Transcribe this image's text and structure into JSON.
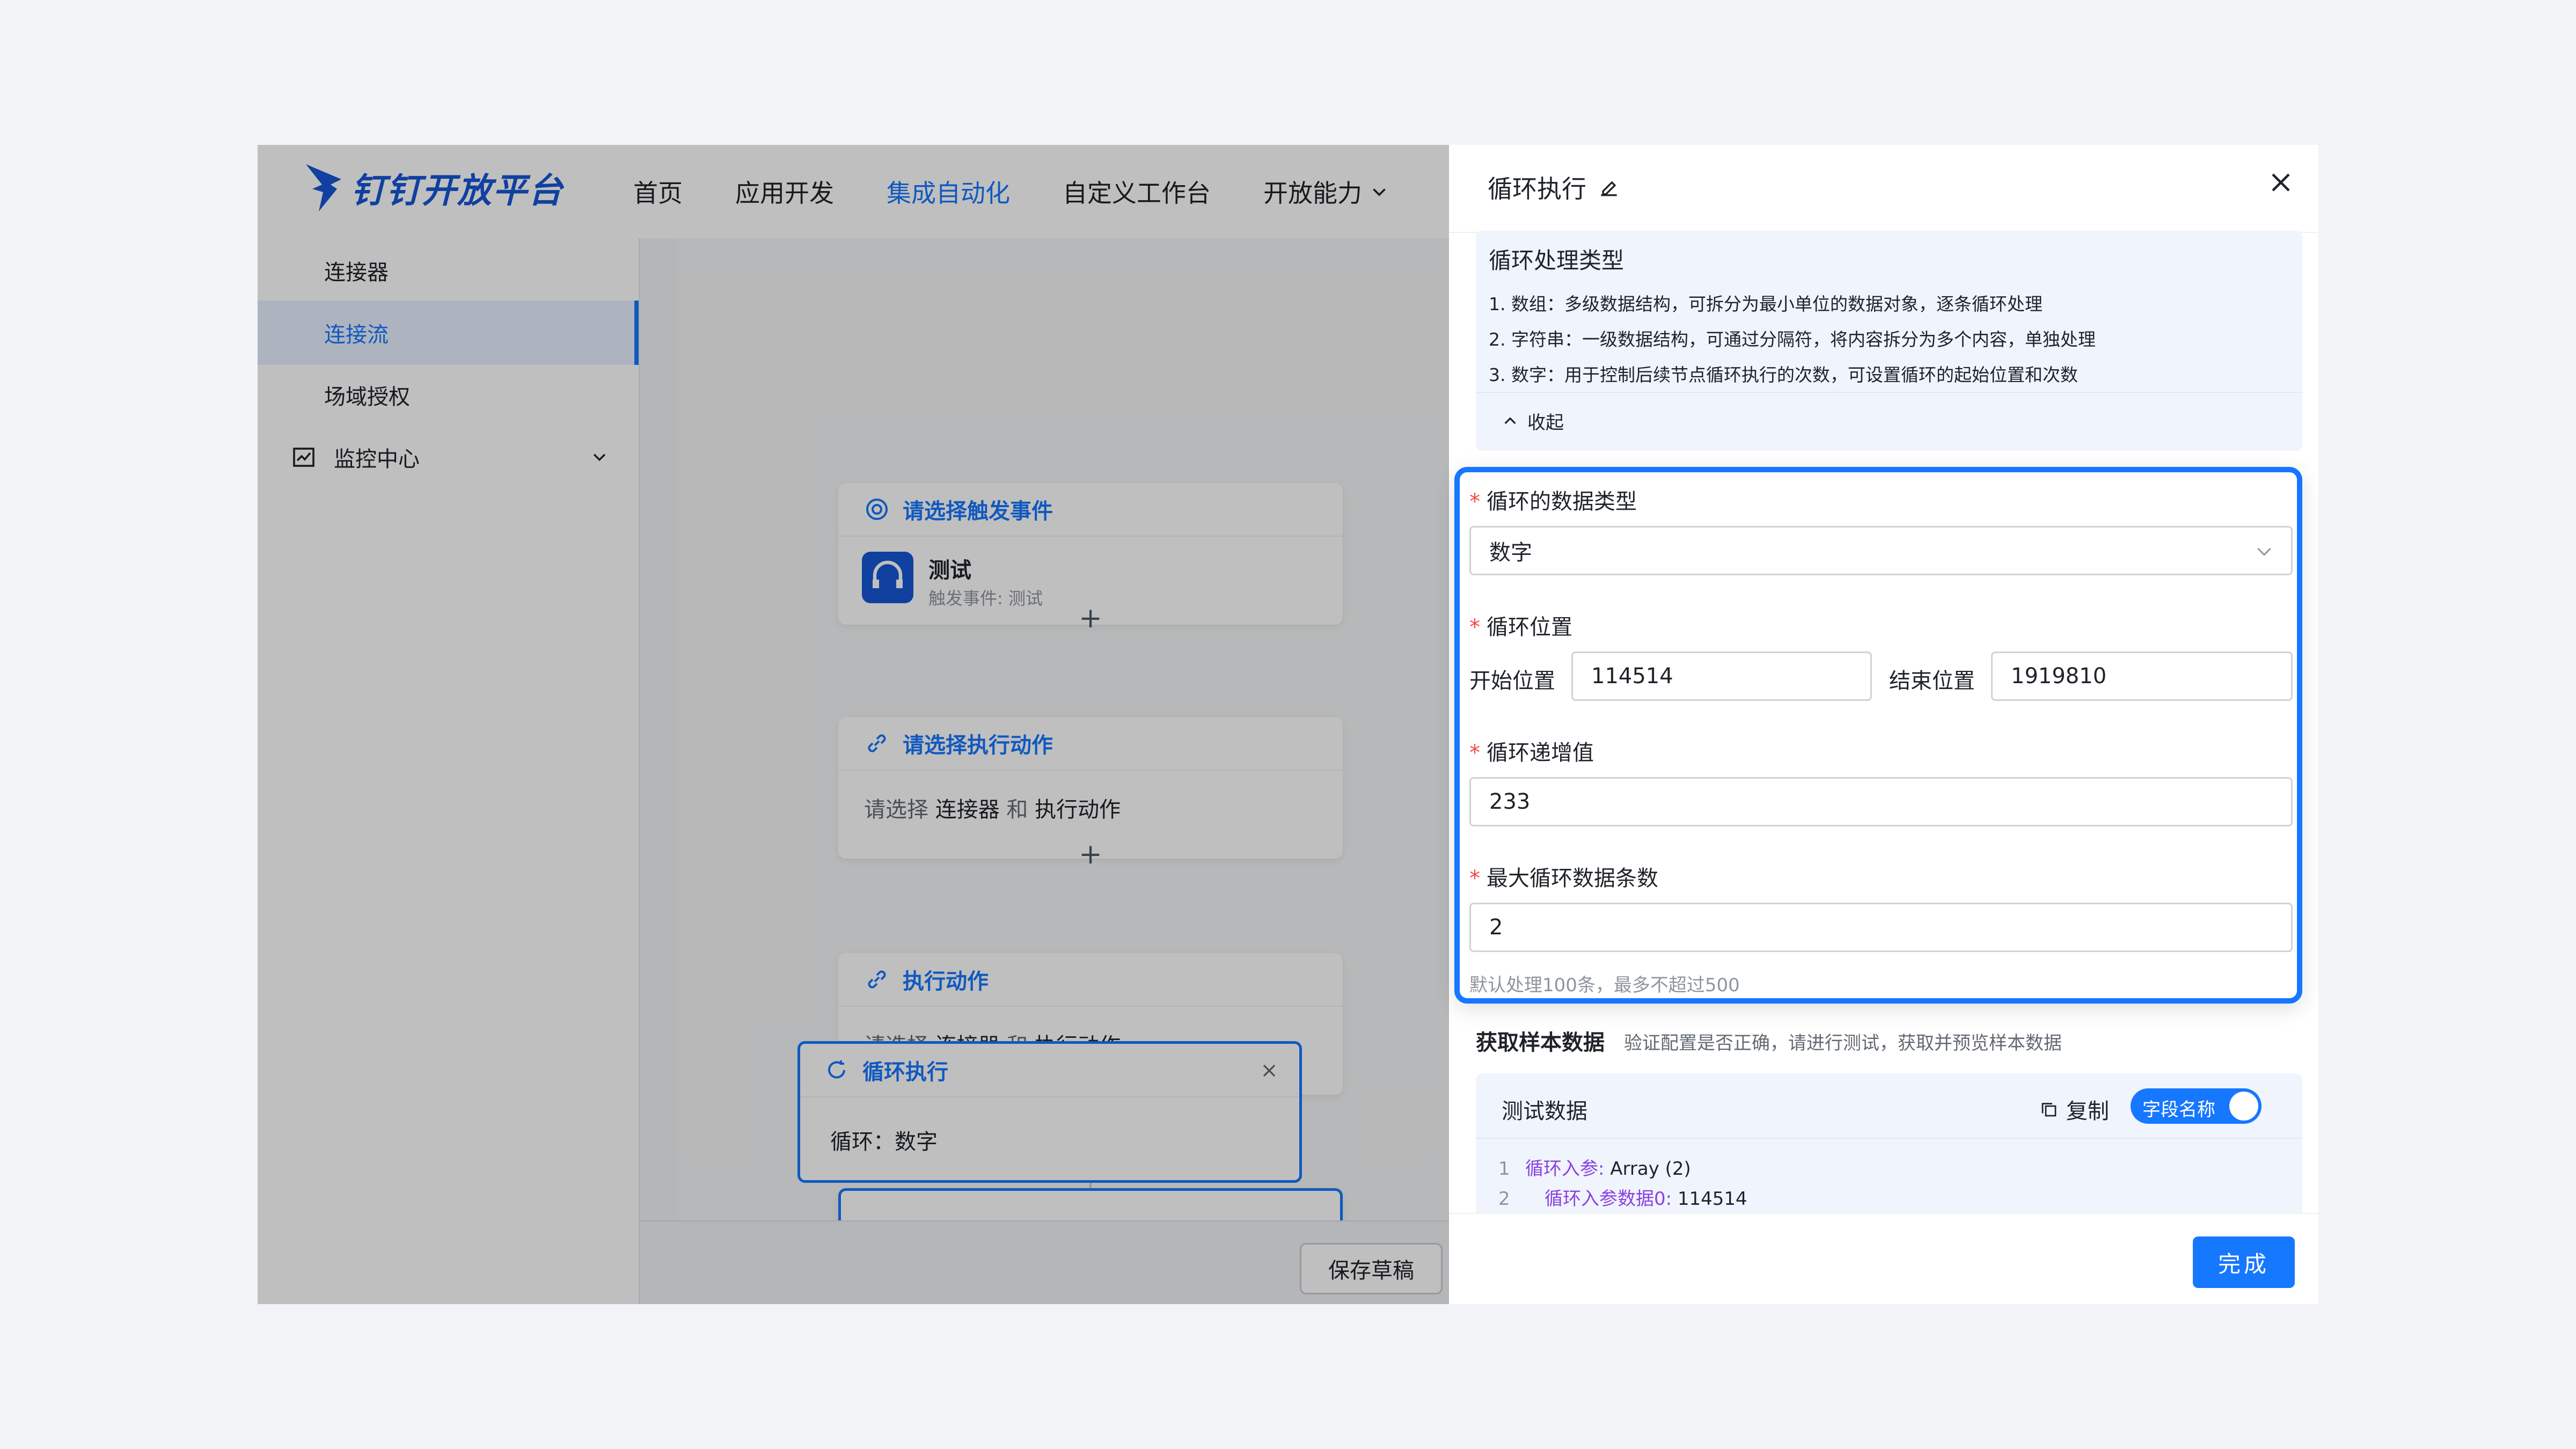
{
  "header": {
    "logo_text": "钉钉开放平台",
    "nav": [
      {
        "label": "首页"
      },
      {
        "label": "应用开发"
      },
      {
        "label": "集成自动化"
      },
      {
        "label": "自定义工作台"
      },
      {
        "label": "开放能力"
      }
    ]
  },
  "sidebar": {
    "items": [
      {
        "label": "连接器"
      },
      {
        "label": "连接流"
      },
      {
        "label": "场域授权"
      },
      {
        "label": "监控中心"
      }
    ]
  },
  "canvas": {
    "node1": {
      "title": "请选择触发事件",
      "app_name": "测试",
      "app_sub": "触发事件: 测试"
    },
    "node2": {
      "title": "请选择执行动作",
      "body_pre": "请选择 ",
      "body_a": "连接器",
      "body_mid": " 和 ",
      "body_b": "执行动作"
    },
    "node3": {
      "title": "执行动作",
      "body_pre": "请选择 ",
      "body_a": "连接器",
      "body_mid": " 和 ",
      "body_b": "执行动作"
    },
    "node4": {
      "title": "循环执行",
      "body": "循环：数字"
    },
    "save_draft": "保存草稿"
  },
  "drawer": {
    "title": "循环执行",
    "info": {
      "title": "循环处理类型",
      "lines": [
        "1. 数组：多级数据结构，可拆分为最小单位的数据对象，逐条循环处理",
        "2. 字符串：一级数据结构，可通过分隔符，将内容拆分为多个内容，单独处理",
        "3. 数字：用于控制后续节点循环执行的次数，可设置循环的起始位置和次数"
      ],
      "collapse": "收起"
    },
    "form": {
      "data_type_label": "循环的数据类型",
      "data_type_value": "数字",
      "position_label": "循环位置",
      "start_label": "开始位置",
      "start_value": "114514",
      "end_label": "结束位置",
      "end_value": "1919810",
      "increment_label": "循环递增值",
      "increment_value": "233",
      "max_label": "最大循环数据条数",
      "max_value": "2",
      "hint": "默认处理100条，最多不超过500"
    },
    "sample": {
      "title": "获取样本数据",
      "desc": "验证配置是否正确，请进行测试，获取并预览样本数据",
      "test_title": "测试数据",
      "copy": "复制",
      "toggle": "字段名称",
      "code": [
        {
          "ln": "1",
          "key": "循环入参:",
          "val": " Array (2)"
        },
        {
          "ln": "2",
          "key": "循环入参数据0:",
          "val": " 114514"
        }
      ]
    },
    "done": "完成"
  },
  "colors": {
    "accent": "#1677ff",
    "required": "#f54a45"
  }
}
